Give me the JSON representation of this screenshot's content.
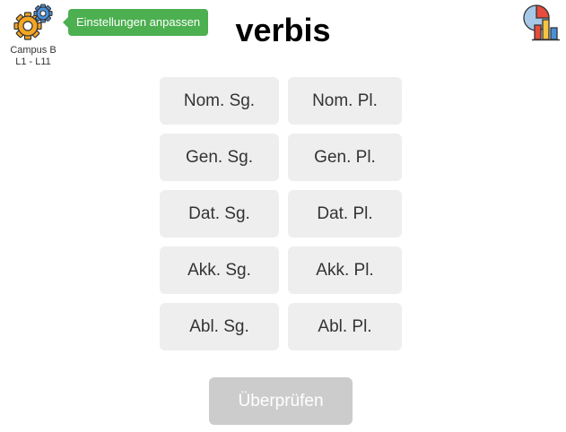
{
  "header": {
    "title": "verbis",
    "settings_tooltip": "Einstellungen anpassen",
    "campus_line1": "Campus B",
    "campus_line2": "L1 - L11"
  },
  "grid": {
    "rows": [
      [
        "Nom. Sg.",
        "Nom. Pl."
      ],
      [
        "Gen. Sg.",
        "Gen. Pl."
      ],
      [
        "Dat. Sg.",
        "Dat. Pl."
      ],
      [
        "Akk. Sg.",
        "Akk. Pl."
      ],
      [
        "Abl. Sg.",
        "Abl. Pl."
      ]
    ]
  },
  "footer": {
    "check_label": "Überprüfen"
  },
  "colors": {
    "tooltip_bg": "#4caf50",
    "button_bg": "#eeeeee",
    "check_disabled_bg": "#cccccc"
  },
  "icons": {
    "settings": "gears-icon",
    "stats": "statistics-icon"
  }
}
